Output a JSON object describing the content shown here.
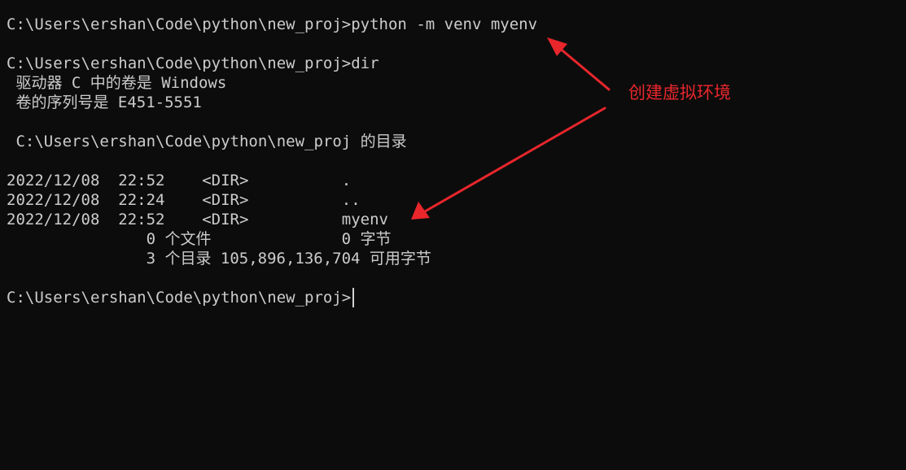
{
  "terminal": {
    "lines": [
      "C:\\Users\\ershan\\Code\\python\\new_proj>python -m venv myenv",
      "",
      "C:\\Users\\ershan\\Code\\python\\new_proj>dir",
      " 驱动器 C 中的卷是 Windows",
      " 卷的序列号是 E451-5551",
      "",
      " C:\\Users\\ershan\\Code\\python\\new_proj 的目录",
      "",
      "2022/12/08  22:52    <DIR>          .",
      "2022/12/08  22:24    <DIR>          ..",
      "2022/12/08  22:52    <DIR>          myenv",
      "               0 个文件              0 字节",
      "               3 个目录 105,896,136,704 可用字节",
      "",
      "C:\\Users\\ershan\\Code\\python\\new_proj>"
    ]
  },
  "annotation": {
    "label": "创建虚拟环境",
    "color": "#e8262c"
  },
  "colors": {
    "background": "#0c0c0c",
    "text": "#cccccc"
  }
}
